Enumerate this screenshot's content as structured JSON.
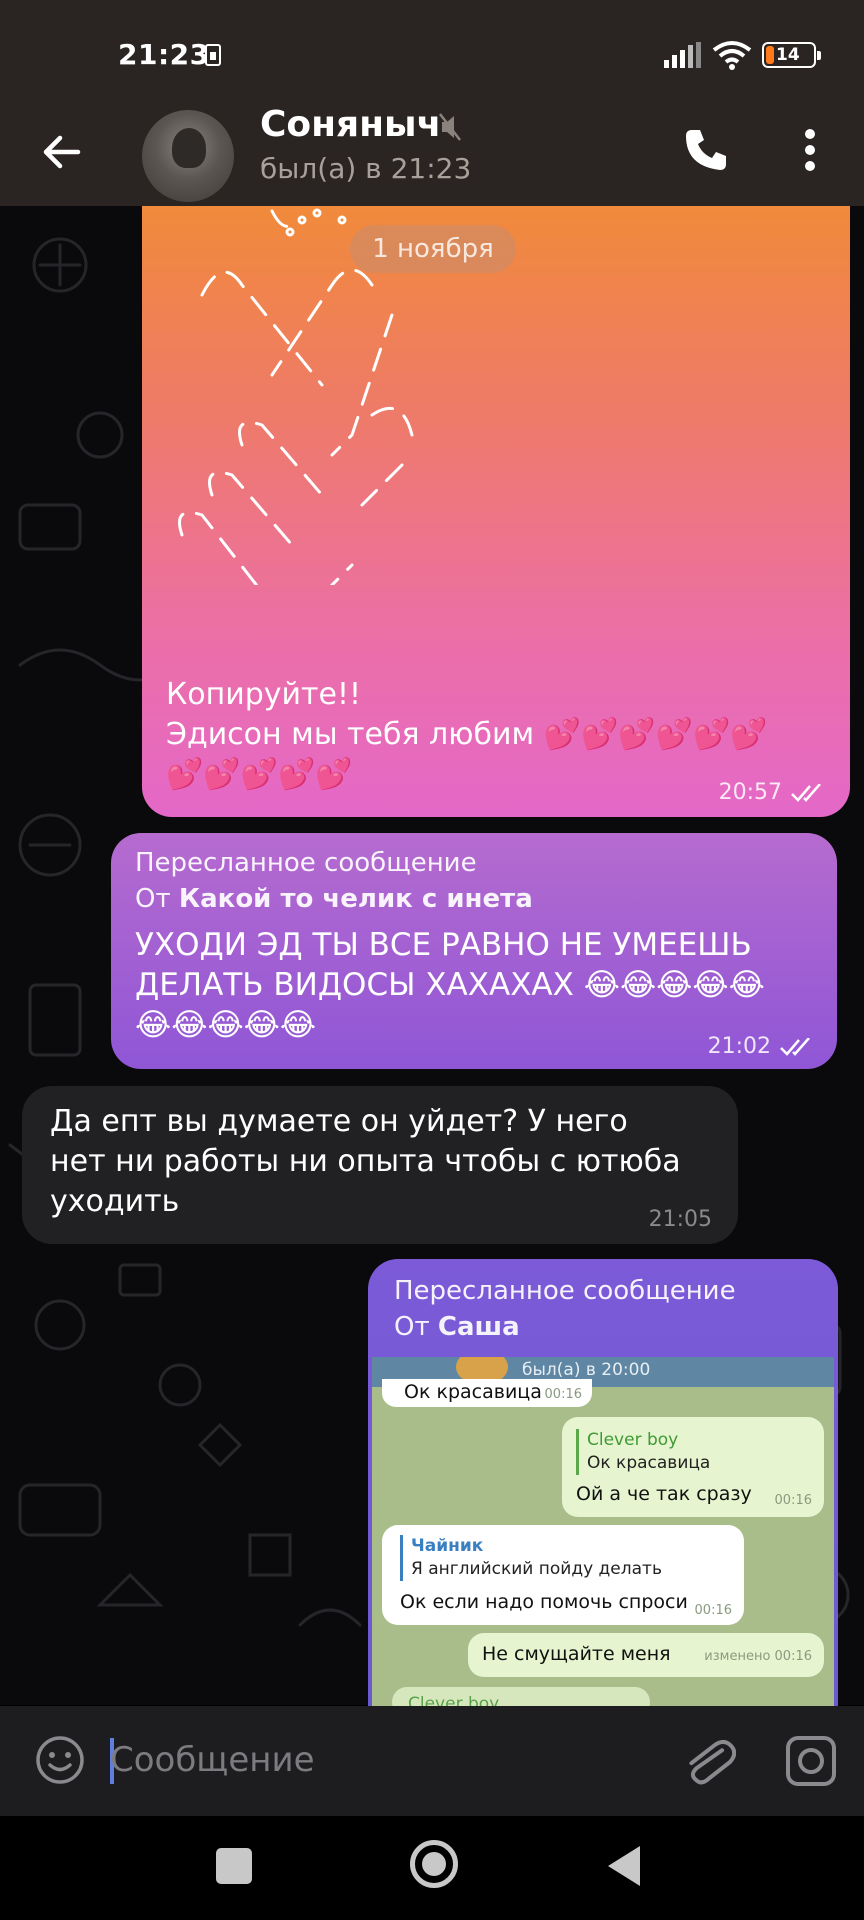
{
  "status_bar": {
    "time": "21:23",
    "battery_level": "14"
  },
  "header": {
    "contact_name": "Соняныч",
    "contact_status": "был(а) в 21:23"
  },
  "date_chip": "1 ноября",
  "messages": [
    {
      "text_line1": "Копируйте!!",
      "text_line2": "Эдисон мы тебя любим 💕💕💕💕💕💕",
      "text_line3": "💕💕💕💕💕",
      "time": "20:57"
    },
    {
      "forwarded_title": "Пересланное сообщение",
      "forwarded_from_prefix": "От ",
      "forwarded_from": "Какой то челик с инета",
      "text_line1": "УХОДИ ЭД ТЫ ВСЕ РАВНО НЕ УМЕЕШЬ",
      "text_line2": "ДЕЛАТЬ ВИДОСЫ ХАХАХАХ 😂😂😂😂😂",
      "text_line3": "😂😂😂😂😂",
      "time": "21:02"
    },
    {
      "text_line1": "Да епт вы думаете он уйдет? У него",
      "text_line2": "нет ни работы ни опыта чтобы с ютюба",
      "text_line3": "уходить",
      "time": "21:05"
    },
    {
      "forwarded_title": "Пересланное сообщение",
      "forwarded_from_prefix": "От ",
      "forwarded_from": "Саша",
      "screenshot": {
        "header_status": "был(а) в 20:00",
        "top_fragment_text": "Ок красавица",
        "top_fragment_time": "00:16",
        "bubble1_name": "Clever boy",
        "bubble1_quote": "Ок красавица",
        "bubble1_text": "Ой а че так сразу",
        "bubble1_time": "00:16",
        "bubble2_name": "Чайник",
        "bubble2_quote": "Я английский пойду делать",
        "bubble2_text": "Ок если надо помочь спроси",
        "bubble2_time": "00:16",
        "bubble3_text": "Не смущайте меня",
        "bubble3_time": "изменено 00:16",
        "bottom_fragment_name": "Clever boy"
      }
    }
  ],
  "input": {
    "placeholder": "Сообщение"
  },
  "colors": {
    "accent": "#5f7fe0",
    "app_bar": "#2a2422",
    "incoming_bubble": "#212123"
  }
}
